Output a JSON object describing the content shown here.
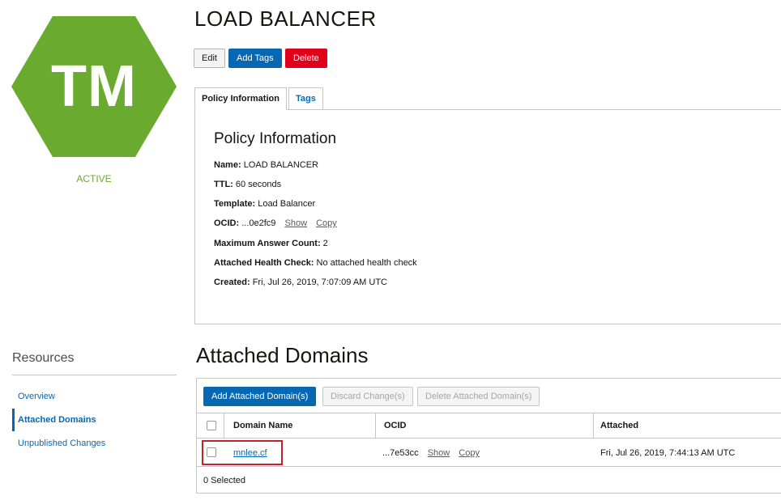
{
  "badge": {
    "initials": "TM",
    "status": "ACTIVE",
    "color": "#6aaa2e"
  },
  "resources": {
    "title": "Resources",
    "items": [
      {
        "label": "Overview",
        "active": false
      },
      {
        "label": "Attached Domains",
        "active": true
      },
      {
        "label": "Unpublished Changes",
        "active": false
      }
    ]
  },
  "header": {
    "title": "LOAD BALANCER",
    "edit_label": "Edit",
    "add_tags_label": "Add Tags",
    "delete_label": "Delete"
  },
  "tabs": [
    {
      "label": "Policy Information",
      "active": true
    },
    {
      "label": "Tags",
      "active": false
    }
  ],
  "policy": {
    "heading": "Policy Information",
    "name_label": "Name:",
    "name_value": "LOAD BALANCER",
    "ttl_label": "TTL:",
    "ttl_value": "60 seconds",
    "template_label": "Template:",
    "template_value": "Load Balancer",
    "ocid_label": "OCID:",
    "ocid_value": "...0e2fc9",
    "ocid_show": "Show",
    "ocid_copy": "Copy",
    "max_label": "Maximum Answer Count:",
    "max_value": "2",
    "health_label": "Attached Health Check:",
    "health_value": "No attached health check",
    "created_label": "Created:",
    "created_value": "Fri, Jul 26, 2019, 7:07:09 AM UTC"
  },
  "domains": {
    "title": "Attached Domains",
    "add_label": "Add Attached Domain(s)",
    "discard_label": "Discard Change(s)",
    "delete_label": "Delete Attached Domain(s)",
    "columns": [
      "Domain Name",
      "OCID",
      "Attached"
    ],
    "rows": [
      {
        "domain": "mnlee.cf",
        "ocid": "...7e53cc",
        "show": "Show",
        "copy": "Copy",
        "attached": "Fri, Jul 26, 2019, 7:44:13 AM UTC"
      }
    ],
    "selected_text": "0 Selected"
  },
  "colors": {
    "accent": "#0668b3",
    "danger": "#e1001a",
    "active_green": "#6aaa2e",
    "highlight": "#c0232b"
  }
}
